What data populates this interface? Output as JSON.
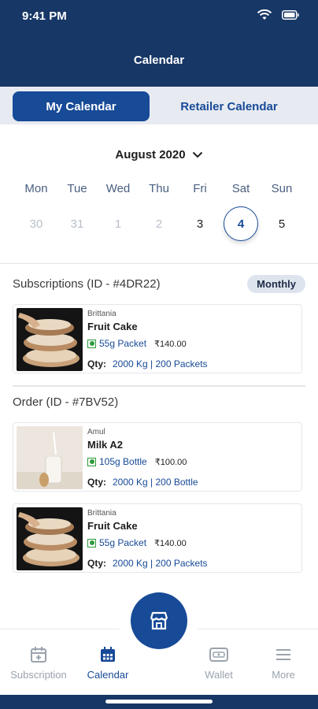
{
  "status": {
    "time": "9:41 PM"
  },
  "header": {
    "title": "Calendar"
  },
  "tabs": {
    "my_calendar": "My Calendar",
    "retailer_calendar": "Retailer Calendar"
  },
  "calendar": {
    "month": "August 2020",
    "weekdays": [
      "Mon",
      "Tue",
      "Wed",
      "Thu",
      "Fri",
      "Sat",
      "Sun"
    ],
    "dates": [
      "30",
      "31",
      "1",
      "2",
      "3",
      "4",
      "5"
    ],
    "selected": "4"
  },
  "subscriptions": {
    "title": "Subscriptions (ID - #4DR22)",
    "badge": "Monthly",
    "items": [
      {
        "brand": "Brittania",
        "name": "Fruit Cake",
        "pack": "55g Packet",
        "price": "₹140.00",
        "qty_label": "Qty:",
        "qty_value": "2000 Kg | 200 Packets"
      }
    ]
  },
  "order": {
    "title": "Order (ID - #7BV52)",
    "items": [
      {
        "brand": "Amul",
        "name": "Milk A2",
        "pack": "105g Bottle",
        "price": "₹100.00",
        "qty_label": "Qty:",
        "qty_value": "2000 Kg | 200 Bottle"
      },
      {
        "brand": "Brittania",
        "name": "Fruit Cake",
        "pack": "55g Packet",
        "price": "₹140.00",
        "qty_label": "Qty:",
        "qty_value": "2000 Kg | 200 Packets"
      }
    ]
  },
  "nav": {
    "subscription": "Subscription",
    "calendar": "Calendar",
    "wallet": "Wallet",
    "more": "More"
  },
  "colors": {
    "primary": "#174a97",
    "header": "#173766",
    "veg": "#2c9b3c"
  }
}
